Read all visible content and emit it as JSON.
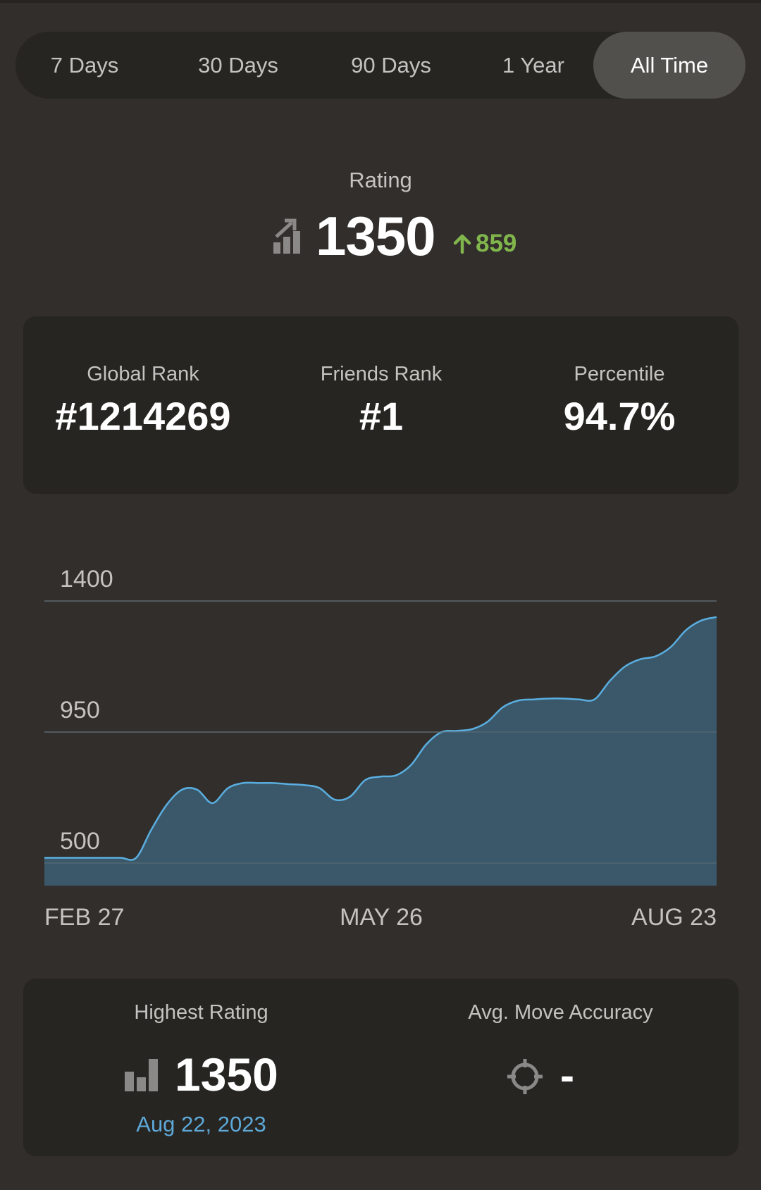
{
  "tabs": [
    {
      "label": "7 Days",
      "active": false
    },
    {
      "label": "30 Days",
      "active": false
    },
    {
      "label": "90 Days",
      "active": false
    },
    {
      "label": "1 Year",
      "active": false
    },
    {
      "label": "All Time",
      "active": true
    }
  ],
  "rating": {
    "label": "Rating",
    "value": "1350",
    "change": "859",
    "change_direction": "up",
    "icon": "rating-trend-icon"
  },
  "ranks": {
    "global": {
      "label": "Global Rank",
      "value": "#1214269"
    },
    "friends": {
      "label": "Friends Rank",
      "value": "#1"
    },
    "percentile": {
      "label": "Percentile",
      "value": "94.7%"
    }
  },
  "chart_data": {
    "type": "area",
    "y_ticks": [
      500,
      950,
      1400
    ],
    "y_tick_labels": [
      "500",
      "950",
      "1400"
    ],
    "x_tick_labels": [
      "FEB 27",
      "MAY 26",
      "AUG 23"
    ],
    "grid": true,
    "x": [
      "2023-02-27",
      "2023-03-03",
      "2023-03-07",
      "2023-03-11",
      "2023-03-15",
      "2023-03-19",
      "2023-03-23",
      "2023-03-27",
      "2023-03-31",
      "2023-04-04",
      "2023-04-08",
      "2023-04-12",
      "2023-04-16",
      "2023-04-20",
      "2023-04-24",
      "2023-04-28",
      "2023-05-02",
      "2023-05-06",
      "2023-05-10",
      "2023-05-14",
      "2023-05-18",
      "2023-05-22",
      "2023-05-26",
      "2023-05-30",
      "2023-06-03",
      "2023-06-07",
      "2023-06-11",
      "2023-06-15",
      "2023-06-19",
      "2023-06-23",
      "2023-06-27",
      "2023-07-01",
      "2023-07-05",
      "2023-07-09",
      "2023-07-13",
      "2023-07-17",
      "2023-07-21",
      "2023-07-25",
      "2023-07-29",
      "2023-08-02",
      "2023-08-06",
      "2023-08-10",
      "2023-08-14",
      "2023-08-18",
      "2023-08-23"
    ],
    "values": [
      518,
      518,
      518,
      518,
      518,
      518,
      518,
      615,
      700,
      752,
      752,
      706,
      757,
      775,
      775,
      775,
      771,
      768,
      758,
      718,
      728,
      785,
      797,
      801,
      837,
      908,
      950,
      954,
      960,
      985,
      1035,
      1058,
      1062,
      1065,
      1065,
      1062,
      1062,
      1125,
      1175,
      1200,
      1210,
      1242,
      1300,
      1333,
      1345
    ],
    "fill_color": "#3c5b6e",
    "line_color": "#5aaee0"
  },
  "highest_rating": {
    "label": "Highest Rating",
    "value": "1350",
    "date": "Aug 22, 2023",
    "icon": "bar-chart-icon"
  },
  "accuracy": {
    "label": "Avg. Move Accuracy",
    "value": "-",
    "icon": "crosshair-icon"
  }
}
